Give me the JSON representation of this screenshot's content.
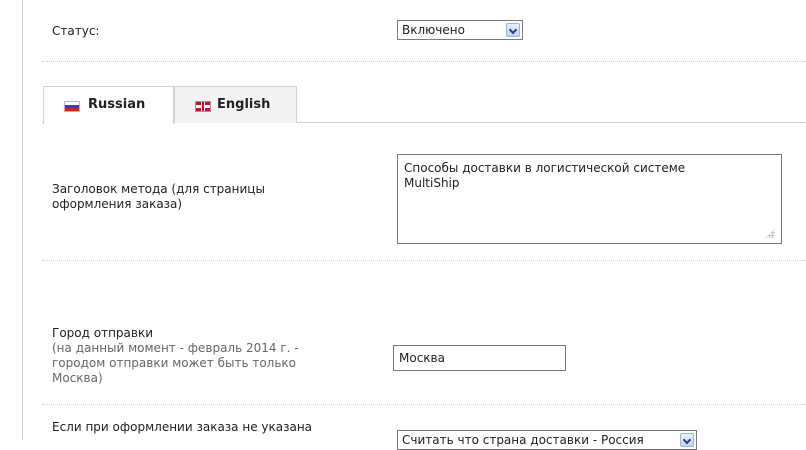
{
  "status": {
    "label": "Статус:",
    "value": "Включено"
  },
  "tabs": [
    {
      "label": "Russian",
      "flag": "russia-flag-icon",
      "active": true
    },
    {
      "label": "English",
      "flag": "uk-flag-icon",
      "active": false
    }
  ],
  "method_title": {
    "label_line1": "Заголовок метода (для страницы",
    "label_line2": "оформления заказа)",
    "value_line1": "Способы доставки в логистической системе",
    "value_line2": "MultiShip"
  },
  "origin_city": {
    "label": "Город отправки",
    "hint_line1": "(на данный момент - февраль 2014 г. -",
    "hint_line2": "городом отправки может быть только",
    "hint_line3": "Москва)",
    "value": "Москва"
  },
  "country_fallback": {
    "label": "Если при оформлении заказа не указана",
    "value": "Считать что страна доставки - Россия"
  }
}
